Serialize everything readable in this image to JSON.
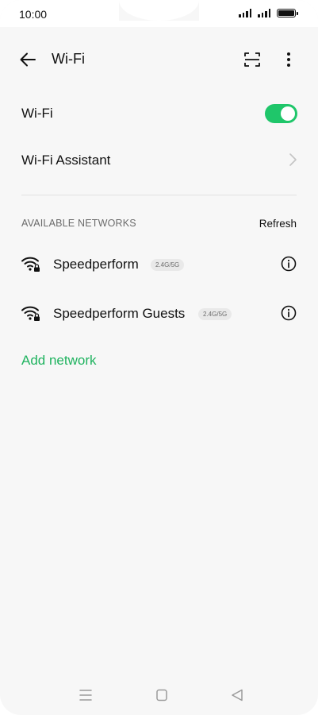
{
  "status_bar": {
    "time": "10:00"
  },
  "header": {
    "title": "Wi-Fi",
    "icons": {
      "back": "back-arrow-icon",
      "scan": "scan-qr-icon",
      "more": "more-vertical-icon"
    }
  },
  "settings": {
    "wifi_label": "Wi-Fi",
    "wifi_enabled": true,
    "assistant_label": "Wi-Fi Assistant"
  },
  "available_networks": {
    "header": "AVAILABLE NETWORKS",
    "refresh_label": "Refresh",
    "networks": [
      {
        "name": "Speedperform",
        "band": "2.4G/5G",
        "secured": true
      },
      {
        "name": "Speedperform Guests",
        "band": "2.4G/5G",
        "secured": true
      }
    ],
    "add_network_label": "Add network"
  },
  "colors": {
    "accent": "#1fc66a",
    "accent_text": "#1fb35f",
    "background": "#f7f7f7"
  }
}
